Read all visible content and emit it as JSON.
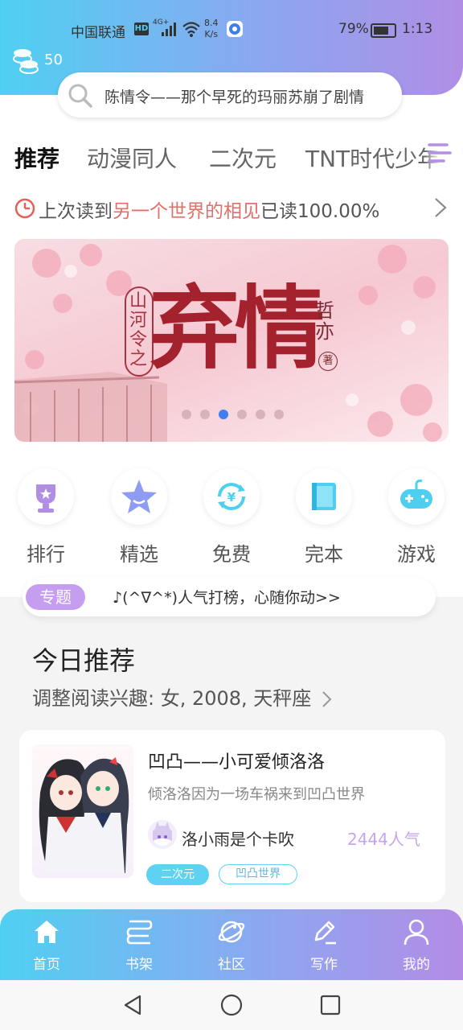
{
  "status_bar": {
    "carrier": "中国联通",
    "hd": "HD",
    "signal": "4G+",
    "speed_value": "8.4",
    "speed_unit": "K/s",
    "battery": "79%",
    "time": "1:13"
  },
  "header": {
    "coin_count": "50",
    "search_placeholder": "陈情令——那个早死的玛丽苏崩了剧情"
  },
  "tabs": [
    {
      "label": "推荐",
      "active": true
    },
    {
      "label": "动漫同人",
      "active": false
    },
    {
      "label": "二次元",
      "active": false
    },
    {
      "label": "TNT时代少年团",
      "active": false
    }
  ],
  "last_read": {
    "prefix": "上次读到",
    "title": "另一个世界的相见",
    "suffix": "已读100.00%"
  },
  "banner": {
    "series": "山河令之",
    "title": "弃情",
    "author": "哲亦",
    "author_suffix": "著",
    "slide_count": 6,
    "active_slide": 3
  },
  "quick_entries": [
    {
      "label": "排行",
      "icon": "trophy-icon"
    },
    {
      "label": "精选",
      "icon": "star-icon"
    },
    {
      "label": "免费",
      "icon": "free-icon"
    },
    {
      "label": "完本",
      "icon": "book-icon"
    },
    {
      "label": "游戏",
      "icon": "gamepad-icon"
    }
  ],
  "topic": {
    "badge": "专题",
    "text": "♪(^∇^*)人气打榜，心随你动>>"
  },
  "today": {
    "title": "今日推荐",
    "interest": "调整阅读兴趣: 女, 2008, 天秤座"
  },
  "book_card": {
    "title": "凹凸——小可爱倾洛洛",
    "description": "倾洛洛因为一场车祸来到凹凸世界",
    "author": "洛小雨是个卡吹",
    "popularity": "2444人气",
    "tags": [
      "二次元",
      "凹凸世界"
    ]
  },
  "bottom_nav": [
    {
      "label": "首页",
      "icon": "home-icon"
    },
    {
      "label": "书架",
      "icon": "bookshelf-icon"
    },
    {
      "label": "社区",
      "icon": "planet-icon"
    },
    {
      "label": "写作",
      "icon": "pen-icon"
    },
    {
      "label": "我的",
      "icon": "user-icon"
    }
  ],
  "colors": {
    "accent_cyan": "#4fd0f2",
    "accent_purple": "#b08ee6",
    "highlight_red": "#e0706a"
  }
}
